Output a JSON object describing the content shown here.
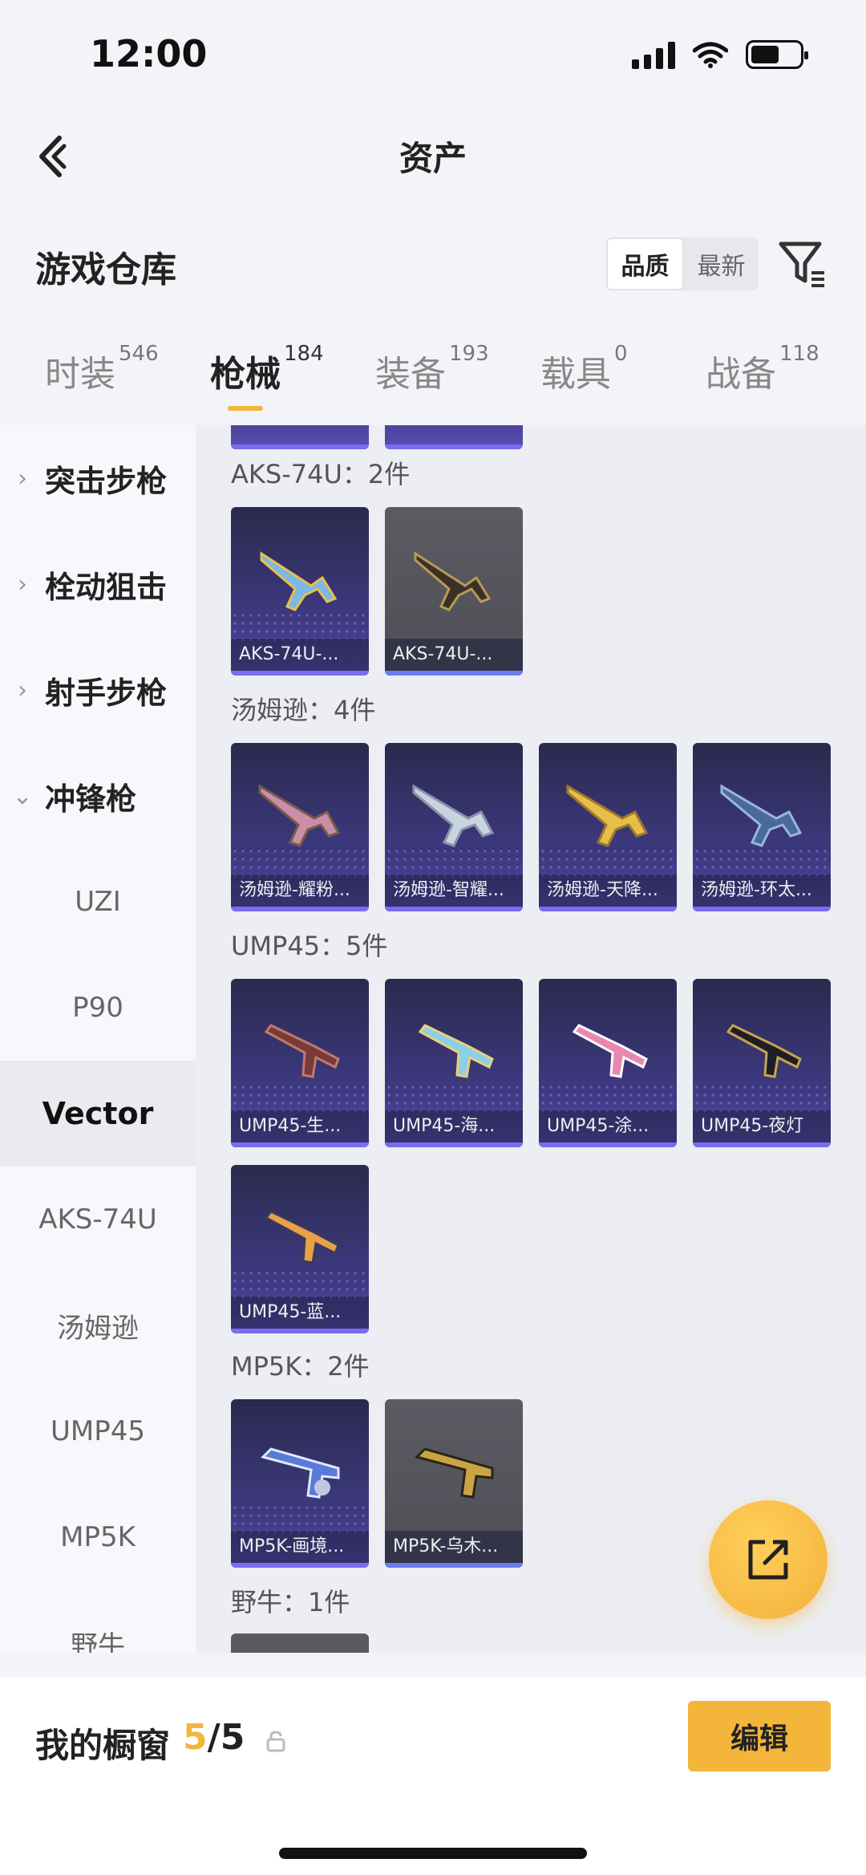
{
  "status_bar": {
    "time": "12:00"
  },
  "header": {
    "title": "资产"
  },
  "warehouse": {
    "title": "游戏仓库",
    "sort_options": [
      "品质",
      "最新"
    ],
    "sort_selected": "品质"
  },
  "tabs": [
    {
      "label": "时装",
      "count": "546"
    },
    {
      "label": "枪械",
      "count": "184",
      "active": true
    },
    {
      "label": "装备",
      "count": "193"
    },
    {
      "label": "载具",
      "count": "0"
    },
    {
      "label": "战备",
      "count": "118"
    }
  ],
  "sidebar": {
    "categories": [
      "突击步枪",
      "栓动狙击",
      "射手步枪",
      "冲锋枪"
    ],
    "sub_items": [
      "UZI",
      "P90",
      "Vector",
      "AKS-74U",
      "汤姆逊",
      "UMP45",
      "MP5K",
      "野牛"
    ],
    "selected": "Vector"
  },
  "groups": [
    {
      "title": "AKS-74U：2件",
      "items": [
        "AKS-74U-...",
        "AKS-74U-..."
      ]
    },
    {
      "title": "汤姆逊：4件",
      "items": [
        "汤姆逊-耀粉...",
        "汤姆逊-智耀...",
        "汤姆逊-天降...",
        "汤姆逊-环太..."
      ]
    },
    {
      "title": "UMP45：5件",
      "items": [
        "UMP45-生...",
        "UMP45-海...",
        "UMP45-涂...",
        "UMP45-夜灯",
        "UMP45-蓝..."
      ]
    },
    {
      "title": "MP5K：2件",
      "items": [
        "MP5K-画境...",
        "MP5K-乌木..."
      ]
    },
    {
      "title": "野牛：1件",
      "items": []
    }
  ],
  "bottom_bar": {
    "label": "我的橱窗",
    "current": "5",
    "total": "/5",
    "edit_label": "编辑"
  },
  "colors": {
    "accent": "#f3b53a",
    "card_purple": "#3f3a84",
    "card_grey": "#55565d"
  },
  "icons": [
    "back-arrow-icon",
    "filter-icon",
    "share-icon",
    "lock-icon",
    "chevron-right-icon",
    "chevron-down-icon"
  ]
}
